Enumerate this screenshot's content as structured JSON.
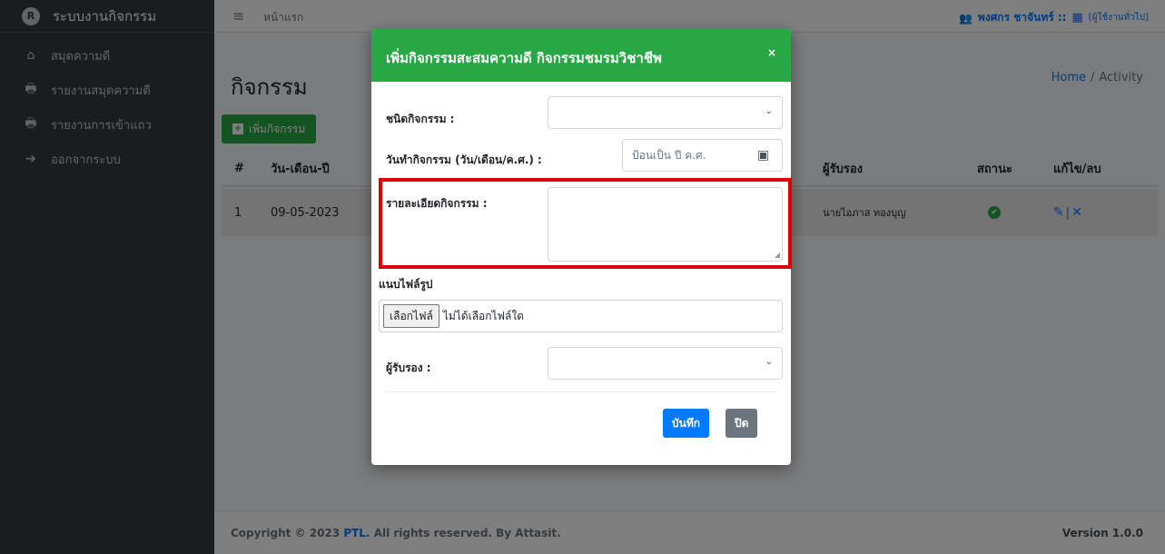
{
  "sidebar": {
    "brand_logo": "R",
    "brand": "ระบบงานกิจกรรม",
    "items": [
      {
        "icon": "home-icon",
        "glyph": "⌂",
        "label": "สมุดความดี"
      },
      {
        "icon": "print-icon",
        "glyph": "🖶",
        "label": "รายงานสมุดความดี"
      },
      {
        "icon": "print-icon",
        "glyph": "🖶",
        "label": "รายงานการเข้าแถว"
      },
      {
        "icon": "logout-icon",
        "glyph": "➔",
        "label": "ออกจากระบบ"
      }
    ]
  },
  "topbar": {
    "menu_glyph": "≡",
    "home": "หน้าแรก",
    "users_glyph": "👥",
    "user_name": "พงศกร ชาจันทร์ ::",
    "grid_glyph": "▦",
    "user_role": "[ผู้ใช้งานทั่วไป]"
  },
  "content": {
    "title": "กิจกรรม",
    "breadcrumb": {
      "home": "Home",
      "separator": "/",
      "current": "Activity"
    },
    "add_button": "เพิ่มกิจกรรม",
    "add_glyph": "+",
    "table": {
      "headers": [
        "#",
        "วัน-เดือน-ปี",
        "ผู้รับรอง",
        "สถานะ",
        "แก้ไข/ลบ"
      ],
      "rows": [
        {
          "num": "1",
          "date": "09-05-2023",
          "approver": "นายไอภาส ทองบุญ",
          "status_glyph": "✔",
          "edit_glyph": "✎",
          "pipe": "|",
          "delete_glyph": "✕"
        }
      ]
    }
  },
  "footer": {
    "copyright_prefix": "Copyright © 2023",
    "brand": "PTL.",
    "copyright_suffix": "All rights reserved. By Attasit.",
    "version": "Version 1.0.0"
  },
  "modal": {
    "title": "เพิ่มกิจกรรมสะสมความดี กิจกรรมชมรมวิชาชีพ",
    "close": "×",
    "fields": {
      "activity_type_label": "ชนิดกิจกรรม :",
      "activity_type_value": "",
      "date_label": "วันทำกิจกรรม (วัน/เดือน/ค.ศ.) :",
      "date_placeholder": "ป้อนเป็น ปี ค.ศ.",
      "calendar_glyph": "▣",
      "details_label": "รายละเอียดกิจกรรม :",
      "details_value": "",
      "photo_label": "แนบไฟล์รูป",
      "file_button": "เลือกไฟล์",
      "file_status": "ไม่ได้เลือกไฟล์ใด",
      "approver_label": "ผู้รับรอง :",
      "approver_value": "",
      "chevron_glyph": "⌄"
    },
    "save_button": "บันทึก",
    "close_button": "ปิด"
  },
  "colors": {
    "sidebar": "#343a40",
    "accent_green": "#28a745",
    "accent_blue": "#007bff",
    "highlight": "#e00000"
  }
}
